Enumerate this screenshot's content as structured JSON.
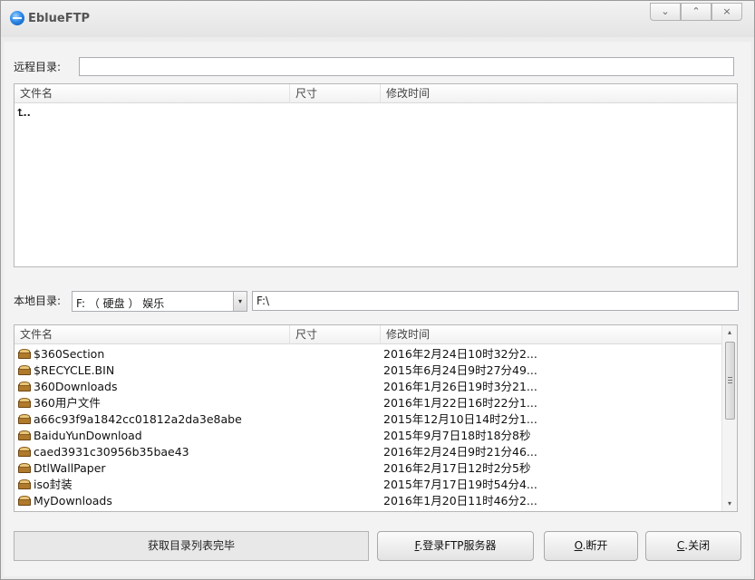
{
  "window": {
    "title": "EblueFTP",
    "min_glyph": "⌄",
    "max_glyph": "⌃",
    "close_glyph": "×"
  },
  "remote": {
    "label": "远程目录:",
    "path_value": "",
    "columns": [
      "文件名",
      "尺寸",
      "修改时间"
    ],
    "up_entry": "..",
    "up_icon_glyph": "⮤"
  },
  "local": {
    "label": "本地目录:",
    "drive_selected": "F: （ 硬盘 ） 娱乐",
    "path_value": "F:\\",
    "columns": [
      "文件名",
      "尺寸",
      "修改时间"
    ],
    "files": [
      {
        "name": "$360Section",
        "size": "",
        "mtime": "2016年2月24日10时32分2..."
      },
      {
        "name": "$RECYCLE.BIN",
        "size": "",
        "mtime": "2015年6月24日9时27分49..."
      },
      {
        "name": "360Downloads",
        "size": "",
        "mtime": "2016年1月26日19时3分21..."
      },
      {
        "name": "360用户文件",
        "size": "",
        "mtime": "2016年1月22日16时22分1..."
      },
      {
        "name": "a66c93f9a1842cc01812a2da3e8abe",
        "size": "",
        "mtime": "2015年12月10日14时2分1..."
      },
      {
        "name": "BaiduYunDownload",
        "size": "",
        "mtime": "2015年9月7日18时18分8秒"
      },
      {
        "name": "caed3931c30956b35bae43",
        "size": "",
        "mtime": "2016年2月24日9时21分46..."
      },
      {
        "name": "DtlWallPaper",
        "size": "",
        "mtime": "2016年2月17日12时2分5秒"
      },
      {
        "name": "iso封装",
        "size": "",
        "mtime": "2015年7月17日19时54分4..."
      },
      {
        "name": "MyDownloads",
        "size": "",
        "mtime": "2016年1月20日11时46分2..."
      }
    ]
  },
  "status_text": "获取目录列表完毕",
  "buttons": {
    "login": {
      "hotkey": "F",
      "rest": ".登录FTP服务器"
    },
    "disconnect": {
      "hotkey": "O",
      "rest": ".断开"
    },
    "close": {
      "hotkey": "C",
      "rest": ".关闭"
    }
  },
  "icons": {
    "folder": "folder-icon",
    "up": "up-arrow-icon",
    "combo_arrow": "▾",
    "scroll_up": "▴",
    "scroll_down": "▾"
  }
}
